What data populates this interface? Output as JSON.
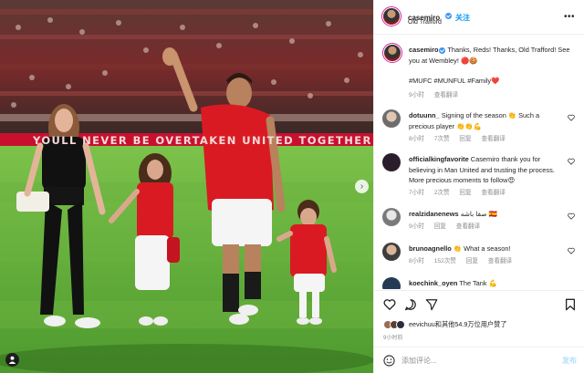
{
  "header": {
    "username": "casemiro",
    "follow_label": "关注",
    "location": "Old Trafford",
    "more_icon": "more-horizontal-icon"
  },
  "photo": {
    "banner_text": "YOULL NEVER BE OVERTAKEN  UNITED TOGETHER  YOULL NEVER BE OVERTAKEN",
    "shirt_color": "#da1a22",
    "pitch_color": "#5aa33a"
  },
  "caption": {
    "username": "casemiro",
    "text": "Thanks, Reds! Thanks, Old Trafford! See you at Wembley! 🔴🍪",
    "hashtags": "#MUFC #MUNFUL #Family❤️",
    "time": "9小时",
    "translate": "查看翻译"
  },
  "comments": [
    {
      "username": "dotuunn_",
      "text": "Signing of the season 👏 Such a precious player 👏👏💪",
      "time": "8小时",
      "likes": "7次赞",
      "reply": "回复",
      "translate": "查看翻译"
    },
    {
      "username": "officialkingfavorite",
      "text": "Casemiro thank you for believing in Man United and trusting the process. More precious moments to follow😍",
      "time": "7小时",
      "likes": "2次赞",
      "reply": "回复",
      "translate": "查看翻译"
    },
    {
      "username": "realzidanenews",
      "text": "صفا باشه 🇪🇸",
      "time": "9小时",
      "likes": "",
      "reply": "回复",
      "translate": "查看翻译"
    },
    {
      "username": "brunoagnello",
      "text": "👏 What a season!",
      "time": "8小时",
      "likes": "152次赞",
      "reply": "回复",
      "translate": "查看翻译"
    },
    {
      "username": "koechink_oyen",
      "text": "The Tank 💪",
      "time": "",
      "likes": "",
      "reply": "",
      "translate": ""
    }
  ],
  "actions": {
    "like_icon": "heart-icon",
    "comment_icon": "comment-icon",
    "share_icon": "paper-plane-icon",
    "save_icon": "bookmark-icon"
  },
  "likes_text": "eevichuu和其他54.9万位用户赞了",
  "post_time": "9小时前",
  "add_comment": {
    "placeholder": "添加评论...",
    "post_label": "发布"
  },
  "colors": {
    "verified": "#3897f0",
    "link": "#0095f6",
    "meta": "#8e8e8e"
  }
}
